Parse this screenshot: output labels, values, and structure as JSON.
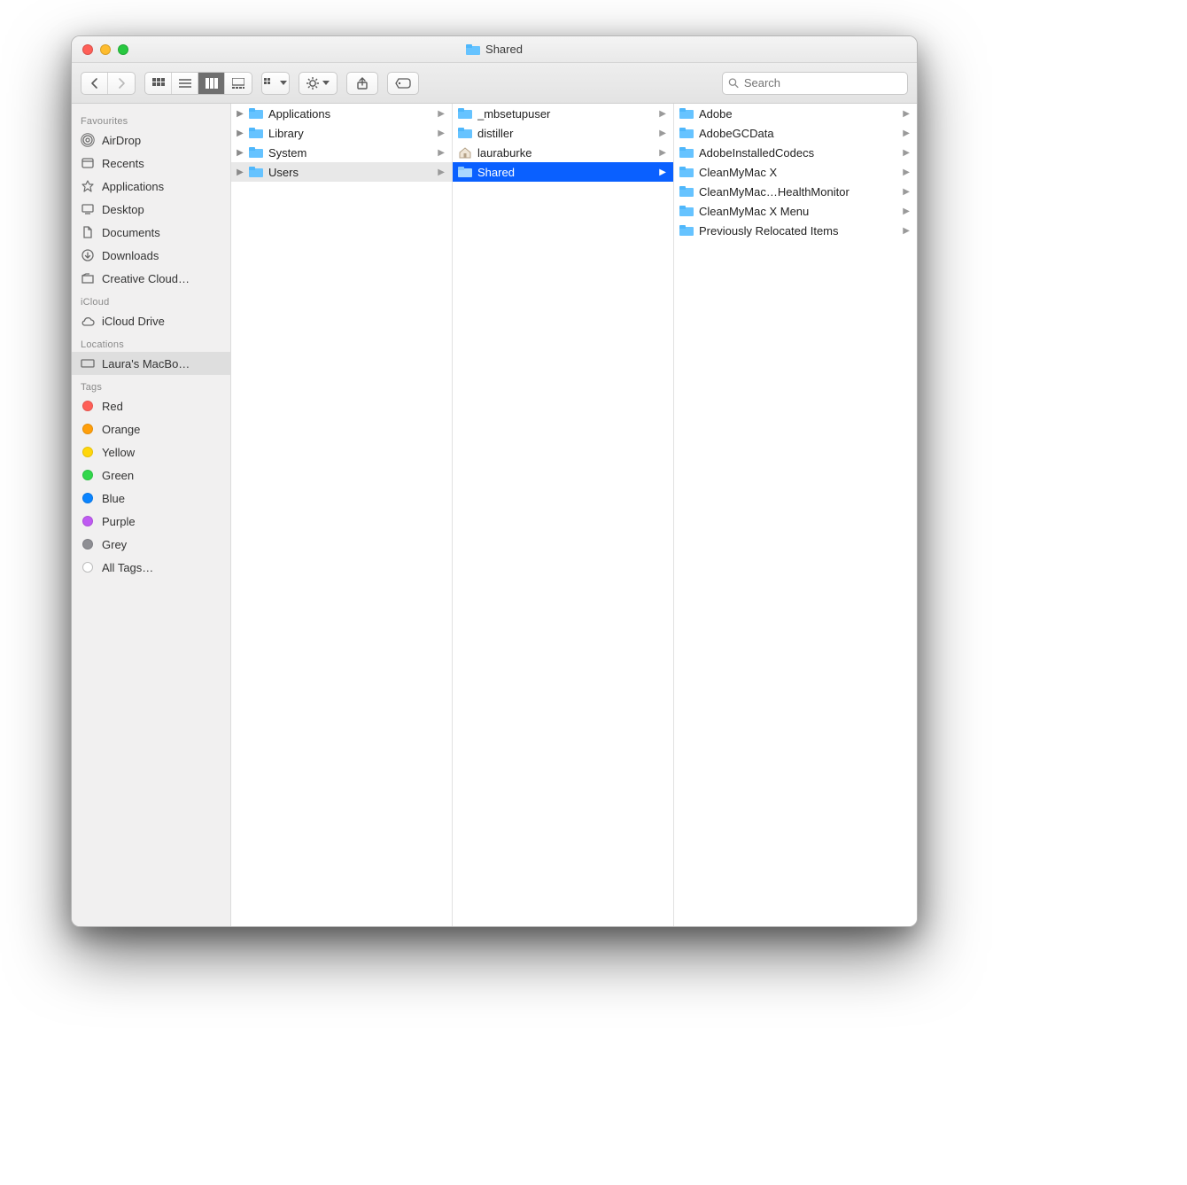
{
  "window_title": "Shared",
  "search": {
    "placeholder": "Search"
  },
  "sidebar": {
    "groups": {
      "favourites_label": "Favourites",
      "icloud_label": "iCloud",
      "locations_label": "Locations",
      "tags_label": "Tags"
    },
    "favourites": [
      {
        "label": "AirDrop"
      },
      {
        "label": "Recents"
      },
      {
        "label": "Applications"
      },
      {
        "label": "Desktop"
      },
      {
        "label": "Documents"
      },
      {
        "label": "Downloads"
      },
      {
        "label": "Creative Cloud…"
      }
    ],
    "icloud": [
      {
        "label": "iCloud Drive"
      }
    ],
    "locations": [
      {
        "label": "Laura's MacBo…",
        "selected": true
      }
    ],
    "tags": [
      {
        "label": "Red",
        "color": "red"
      },
      {
        "label": "Orange",
        "color": "orange"
      },
      {
        "label": "Yellow",
        "color": "yellow"
      },
      {
        "label": "Green",
        "color": "green"
      },
      {
        "label": "Blue",
        "color": "blue"
      },
      {
        "label": "Purple",
        "color": "purple"
      },
      {
        "label": "Grey",
        "color": "grey"
      },
      {
        "label": "All Tags…",
        "color": "all"
      }
    ]
  },
  "columns": [
    {
      "items": [
        {
          "name": "Applications",
          "hasChildren": true
        },
        {
          "name": "Library",
          "hasChildren": true
        },
        {
          "name": "System",
          "hasChildren": true
        },
        {
          "name": "Users",
          "hasChildren": true,
          "selected": "inactive"
        }
      ]
    },
    {
      "items": [
        {
          "name": "_mbsetupuser",
          "hasChildren": true
        },
        {
          "name": "distiller",
          "hasChildren": true
        },
        {
          "name": "lauraburke",
          "hasChildren": true,
          "icon": "home"
        },
        {
          "name": "Shared",
          "hasChildren": true,
          "selected": "active"
        }
      ]
    },
    {
      "items": [
        {
          "name": "Adobe",
          "hasChildren": true
        },
        {
          "name": "AdobeGCData",
          "hasChildren": true
        },
        {
          "name": "AdobeInstalledCodecs",
          "hasChildren": true
        },
        {
          "name": "CleanMyMac X",
          "hasChildren": true
        },
        {
          "name": "CleanMyMac…HealthMonitor",
          "hasChildren": true
        },
        {
          "name": "CleanMyMac X Menu",
          "hasChildren": true
        },
        {
          "name": "Previously Relocated Items",
          "hasChildren": true
        }
      ]
    }
  ]
}
